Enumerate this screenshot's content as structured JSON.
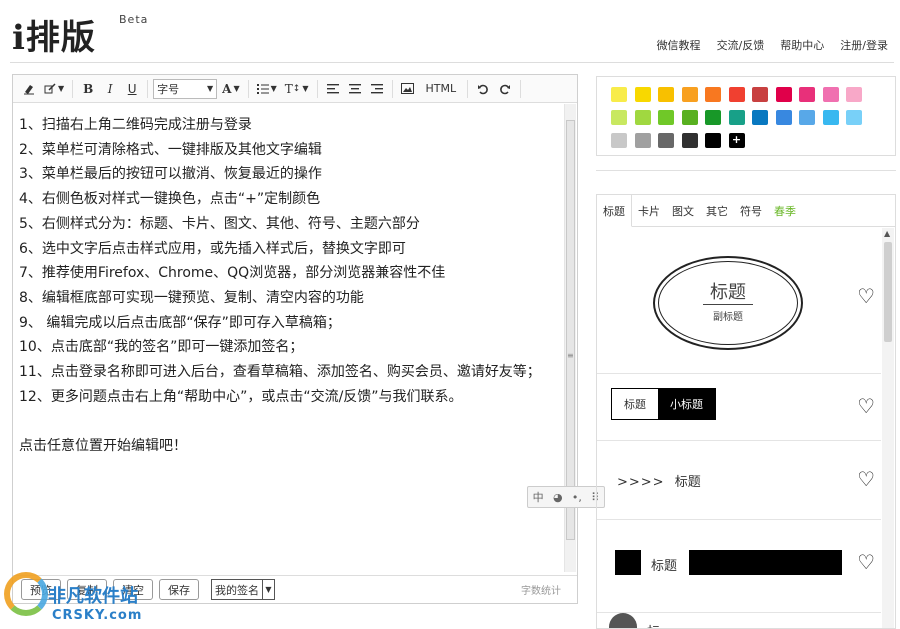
{
  "header": {
    "logo": "i排版",
    "beta": "Beta",
    "nav": [
      "微信教程",
      "交流/反馈",
      "帮助中心",
      "注册/登录"
    ]
  },
  "toolbar": {
    "font_size_label": "字号",
    "font_color_label": "A",
    "html_label": "HTML",
    "bold": "B",
    "italic": "I",
    "underline": "U"
  },
  "editor": {
    "lines": [
      "1、扫描右上角二维码完成注册与登录",
      "2、菜单栏可清除格式、一键排版及其他文字编辑",
      "3、菜单栏最后的按钮可以撤消、恢复最近的操作",
      "4、右侧色板对样式一键换色，点击“+”定制颜色",
      "5、右侧样式分为：标题、卡片、图文、其他、符号、主题六部分",
      "6、选中文字后点击样式应用，或先插入样式后，替换文字即可",
      "7、推荐使用Firefox、Chrome、QQ浏览器，部分浏览器兼容性不佳",
      "8、编辑框底部可实现一键预览、复制、清空内容的功能",
      "9、 编辑完成以后点击底部“保存”即可存入草稿箱；",
      "10、点击底部“我的签名”即可一键添加签名；",
      "11、点击登录名称即可进入后台，查看草稿箱、添加签名、购买会员、邀请好友等；",
      "12、更多问题点击右上角“帮助中心”，或点击“交流/反馈”与我们联系。",
      "",
      "点击任意位置开始编辑吧！"
    ],
    "float_tools": [
      "中",
      "◕",
      "•,",
      "⠿"
    ]
  },
  "bottom": {
    "buttons": [
      "预览",
      "复制",
      "清空",
      "保存"
    ],
    "signature": "我的签名",
    "word_count": "字数统计"
  },
  "watermark": {
    "text": "非凡软件站",
    "url": "CRSKY.com"
  },
  "colors": [
    "#f8ec4a",
    "#f8d800",
    "#f8c000",
    "#f8a020",
    "#f87820",
    "#f04030",
    "#c84040",
    "#e0004a",
    "#e8307a",
    "#f070b0",
    "#f8a8c8",
    "#c8e860",
    "#a0d840",
    "#70c828",
    "#58b020",
    "#189828",
    "#18a088",
    "#0878c0",
    "#3888e0",
    "#58a8e8",
    "#38b8f0",
    "#78d0f8",
    "#c8c8c8",
    "#a0a0a0",
    "#686868",
    "#303030",
    "#000000"
  ],
  "add_color": "+",
  "style_panel": {
    "tabs": [
      "标题",
      "卡片",
      "图文",
      "其它",
      "符号",
      "春季"
    ],
    "items": [
      {
        "title": "标题",
        "subtitle": "副标题"
      },
      {
        "left": "标题",
        "right": "小标题"
      },
      {
        "arrows": ">>>>",
        "title": "标题"
      },
      {
        "title": "标题"
      },
      {
        "title": "标题"
      }
    ]
  }
}
